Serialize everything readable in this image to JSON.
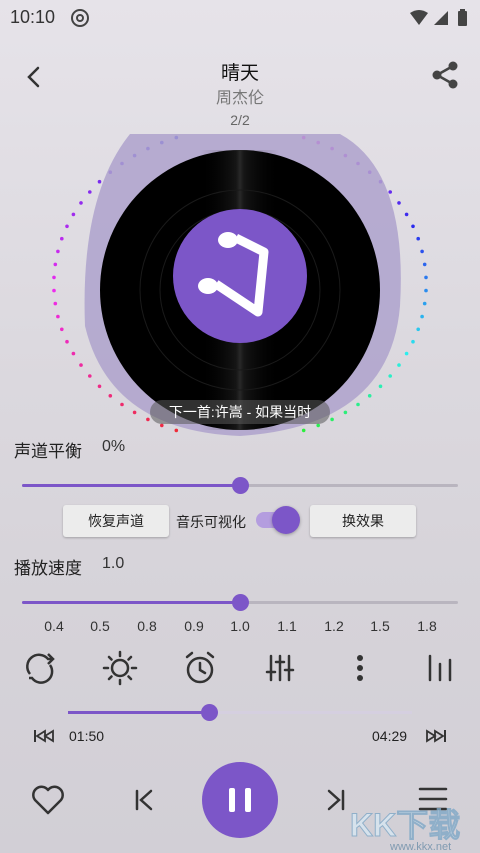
{
  "status": {
    "time": "10:10"
  },
  "header": {
    "title": "晴天",
    "artist": "周杰伦",
    "page": "2/2"
  },
  "next_up": "下一首:许嵩 - 如果当时",
  "balance": {
    "label": "声道平衡",
    "value": "0%",
    "level_fraction": 0.5
  },
  "buttons": {
    "reset_channel": "恢复声道",
    "visualize_label": "音乐可视化",
    "visualize_on": true,
    "change_effect": "换效果"
  },
  "speed": {
    "label": "播放速度",
    "value": "1.0",
    "level_fraction": 0.5,
    "ticks": [
      "0.4",
      "0.5",
      "0.8",
      "0.9",
      "1.0",
      "1.1",
      "1.2",
      "1.5",
      "1.8"
    ]
  },
  "tools": [
    "repeat-icon",
    "brightness-icon",
    "alarm-icon",
    "equalizer-icon",
    "more-vertical-icon",
    "bars-chart-icon"
  ],
  "playback": {
    "elapsed": "01:50",
    "total": "04:29",
    "progress_fraction": 0.41
  },
  "controls": [
    "heart-icon",
    "previous-icon",
    "pause-icon",
    "next-icon",
    "playlist-icon"
  ],
  "watermark": {
    "text": "KK下载",
    "url": "www.kkx.net"
  },
  "colors": {
    "accent": "#7c56c8",
    "disc": "#000000",
    "halo": "#aea2cc"
  }
}
